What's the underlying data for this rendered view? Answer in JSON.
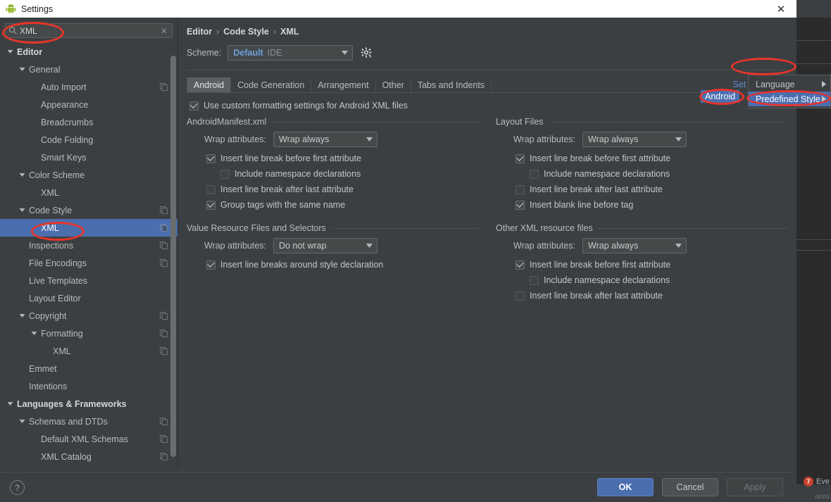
{
  "window": {
    "title": "Settings",
    "close_label": "✕",
    "app_icon": "android-robot-icon"
  },
  "background": {
    "event_badge_count": "7",
    "event_label": "Eve",
    "bottom_text": "aces"
  },
  "search": {
    "value": "XML",
    "placeholder": "",
    "clear_label": "✕",
    "icon": "search-icon"
  },
  "sidebar": {
    "items": [
      {
        "label": "Editor",
        "indent": 0,
        "arrow": "down",
        "bold": true,
        "copy": false,
        "selected": false
      },
      {
        "label": "General",
        "indent": 1,
        "arrow": "down",
        "bold": false,
        "copy": false,
        "selected": false
      },
      {
        "label": "Auto Import",
        "indent": 2,
        "arrow": "none",
        "bold": false,
        "copy": true,
        "selected": false
      },
      {
        "label": "Appearance",
        "indent": 2,
        "arrow": "none",
        "bold": false,
        "copy": false,
        "selected": false
      },
      {
        "label": "Breadcrumbs",
        "indent": 2,
        "arrow": "none",
        "bold": false,
        "copy": false,
        "selected": false
      },
      {
        "label": "Code Folding",
        "indent": 2,
        "arrow": "none",
        "bold": false,
        "copy": false,
        "selected": false
      },
      {
        "label": "Smart Keys",
        "indent": 2,
        "arrow": "none",
        "bold": false,
        "copy": false,
        "selected": false
      },
      {
        "label": "Color Scheme",
        "indent": 1,
        "arrow": "down",
        "bold": false,
        "copy": false,
        "selected": false
      },
      {
        "label": "XML",
        "indent": 2,
        "arrow": "none",
        "bold": false,
        "copy": false,
        "selected": false
      },
      {
        "label": "Code Style",
        "indent": 1,
        "arrow": "down",
        "bold": false,
        "copy": true,
        "selected": false
      },
      {
        "label": "XML",
        "indent": 2,
        "arrow": "none",
        "bold": false,
        "copy": true,
        "selected": true
      },
      {
        "label": "Inspections",
        "indent": 1,
        "arrow": "none",
        "bold": false,
        "copy": true,
        "selected": false
      },
      {
        "label": "File Encodings",
        "indent": 1,
        "arrow": "none",
        "bold": false,
        "copy": true,
        "selected": false
      },
      {
        "label": "Live Templates",
        "indent": 1,
        "arrow": "none",
        "bold": false,
        "copy": false,
        "selected": false
      },
      {
        "label": "Layout Editor",
        "indent": 1,
        "arrow": "none",
        "bold": false,
        "copy": false,
        "selected": false
      },
      {
        "label": "Copyright",
        "indent": 1,
        "arrow": "down",
        "bold": false,
        "copy": true,
        "selected": false
      },
      {
        "label": "Formatting",
        "indent": 2,
        "arrow": "down",
        "bold": false,
        "copy": true,
        "selected": false
      },
      {
        "label": "XML",
        "indent": 3,
        "arrow": "none",
        "bold": false,
        "copy": true,
        "selected": false
      },
      {
        "label": "Emmet",
        "indent": 1,
        "arrow": "none",
        "bold": false,
        "copy": false,
        "selected": false
      },
      {
        "label": "Intentions",
        "indent": 1,
        "arrow": "none",
        "bold": false,
        "copy": false,
        "selected": false
      },
      {
        "label": "Languages & Frameworks",
        "indent": 0,
        "arrow": "down",
        "bold": true,
        "copy": false,
        "selected": false
      },
      {
        "label": "Schemas and DTDs",
        "indent": 1,
        "arrow": "down",
        "bold": false,
        "copy": true,
        "selected": false
      },
      {
        "label": "Default XML Schemas",
        "indent": 2,
        "arrow": "none",
        "bold": false,
        "copy": true,
        "selected": false
      },
      {
        "label": "XML Catalog",
        "indent": 2,
        "arrow": "none",
        "bold": false,
        "copy": true,
        "selected": false
      }
    ]
  },
  "breadcrumb": {
    "items": [
      "Editor",
      "Code Style",
      "XML"
    ],
    "separator": "›"
  },
  "scheme": {
    "label": "Scheme:",
    "value_main": "Default",
    "value_sub": "IDE",
    "gear_icon": "gear-icon"
  },
  "tabs": [
    {
      "label": "Tabs and Indents",
      "active": false
    },
    {
      "label": "Other",
      "active": false
    },
    {
      "label": "Arrangement",
      "active": false
    },
    {
      "label": "Code Generation",
      "active": false
    },
    {
      "label": "Android",
      "active": true
    }
  ],
  "set_from": {
    "label": "Set from..."
  },
  "menu": {
    "items": [
      {
        "label": "Language",
        "submenu": true,
        "highlight": false
      },
      {
        "label": "Predefined Style",
        "submenu": true,
        "highlight": true
      }
    ],
    "chip_label": "Android"
  },
  "main": {
    "use_custom": {
      "label": "Use custom formatting settings for Android XML files",
      "checked": true
    },
    "groups": [
      {
        "id": "manifest",
        "title": "AndroidManifest.xml",
        "column": "left",
        "wrap_label": "Wrap attributes:",
        "wrap_value": "Wrap always",
        "checks": [
          {
            "label": "Insert line break before first attribute",
            "checked": true,
            "indent": false
          },
          {
            "label": "Include namespace declarations",
            "checked": false,
            "indent": true
          },
          {
            "label": "Insert line break after last attribute",
            "checked": false,
            "indent": false
          },
          {
            "label": "Group tags with the same name",
            "checked": true,
            "indent": false
          }
        ]
      },
      {
        "id": "value-resource",
        "title": "Value Resource Files and Selectors",
        "column": "left",
        "wrap_label": "Wrap attributes:",
        "wrap_value": "Do not wrap",
        "checks": [
          {
            "label": "Insert line breaks around style declaration",
            "checked": true,
            "indent": false
          }
        ]
      },
      {
        "id": "layout-files",
        "title": "Layout Files",
        "column": "right",
        "wrap_label": "Wrap attributes:",
        "wrap_value": "Wrap always",
        "checks": [
          {
            "label": "Insert line break before first attribute",
            "checked": true,
            "indent": false
          },
          {
            "label": "Include namespace declarations",
            "checked": false,
            "indent": true
          },
          {
            "label": "Insert line break after last attribute",
            "checked": false,
            "indent": false
          },
          {
            "label": "Insert blank line before tag",
            "checked": true,
            "indent": false
          }
        ]
      },
      {
        "id": "other-xml",
        "title": "Other XML resource files",
        "column": "right",
        "wrap_label": "Wrap attributes:",
        "wrap_value": "Wrap always",
        "checks": [
          {
            "label": "Insert line break before first attribute",
            "checked": true,
            "indent": false
          },
          {
            "label": "Include namespace declarations",
            "checked": false,
            "indent": true
          },
          {
            "label": "Insert line break after last attribute",
            "checked": false,
            "indent": false
          }
        ]
      }
    ]
  },
  "footer": {
    "help_label": "?",
    "ok_label": "OK",
    "cancel_label": "Cancel",
    "apply_label": "Apply"
  },
  "colors": {
    "accent_blue": "#4b6eaf",
    "link_blue": "#5e8ed4",
    "annotation_red": "#e8342a",
    "window_bg": "#3c3f41"
  }
}
